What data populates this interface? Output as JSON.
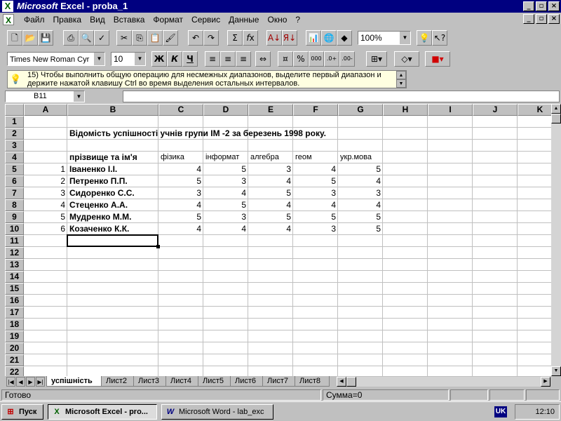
{
  "window": {
    "title_brand": "Microsoft",
    "title_rest": " Excel - proba_1",
    "app_icon": "excel-icon"
  },
  "menu": {
    "items": [
      "Файл",
      "Правка",
      "Вид",
      "Вставка",
      "Формат",
      "Сервис",
      "Данные",
      "Окно",
      "?"
    ]
  },
  "toolbar": {
    "zoom": "100%",
    "font_name": "Times New Roman Cyr",
    "font_size": "10",
    "bold": "Ж",
    "italic": "К",
    "underline": "Ч"
  },
  "tip": {
    "text": "15) Чтобы выполнить общую операцию для несмежных диапазонов, выделите первый диапазон и держите нажатой клавишу Ctrl во время выделения остальных интервалов."
  },
  "formula_bar": {
    "name_box": "B11",
    "value": ""
  },
  "sheet": {
    "columns": [
      "A",
      "B",
      "C",
      "D",
      "E",
      "F",
      "G",
      "H",
      "I",
      "J",
      "K"
    ],
    "rows": [
      "1",
      "2",
      "3",
      "4",
      "5",
      "6",
      "7",
      "8",
      "9",
      "10",
      "11",
      "12",
      "13",
      "14",
      "15",
      "16",
      "17",
      "18",
      "19",
      "20",
      "21",
      "22"
    ],
    "title": "Відомість успішності учнів групи ІМ -2 за березень 1998 року.",
    "header": {
      "name": "прізвище та ім'я",
      "subjects": [
        "фізика",
        "інформат",
        "алгебра",
        "геом",
        "укр.мова"
      ]
    },
    "students": [
      {
        "n": "1",
        "name": "Іваненко І.І.",
        "grades": [
          "4",
          "5",
          "3",
          "4",
          "5"
        ]
      },
      {
        "n": "2",
        "name": "Петренко П.П.",
        "grades": [
          "5",
          "3",
          "4",
          "5",
          "4"
        ]
      },
      {
        "n": "3",
        "name": "Сидоренко С.С.",
        "grades": [
          "3",
          "4",
          "5",
          "3",
          "3"
        ]
      },
      {
        "n": "4",
        "name": "Стеценко А.А.",
        "grades": [
          "4",
          "5",
          "4",
          "4",
          "4"
        ]
      },
      {
        "n": "5",
        "name": "Мудренко М.М.",
        "grades": [
          "5",
          "3",
          "5",
          "5",
          "5"
        ]
      },
      {
        "n": "6",
        "name": "Козаченко К.К.",
        "grades": [
          "4",
          "4",
          "4",
          "3",
          "5"
        ]
      }
    ]
  },
  "tabs": [
    "успішність",
    "Лист2",
    "Лист3",
    "Лист4",
    "Лист5",
    "Лист6",
    "Лист7",
    "Лист8"
  ],
  "status": {
    "ready": "Готово",
    "sum": "Сумма=0"
  },
  "taskbar": {
    "start": "Пуск",
    "excel": "Microsoft Excel - pro...",
    "word": "Microsoft Word - lab_exc",
    "lang": "UK",
    "clock": "12:10"
  }
}
